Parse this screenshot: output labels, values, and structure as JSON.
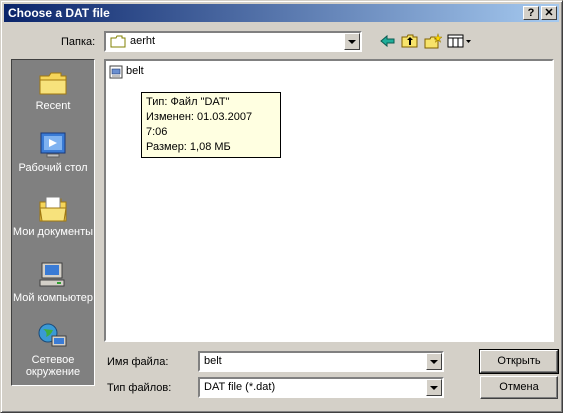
{
  "window": {
    "title": "Choose a DAT file",
    "help_label": "?",
    "close_label": "✕"
  },
  "lookin": {
    "label": "Папка:",
    "value": "aerht"
  },
  "toolbar": {
    "icons": [
      "back-icon",
      "up-folder-icon",
      "new-folder-icon",
      "view-menu-icon"
    ]
  },
  "places": [
    {
      "label": "Recent",
      "icon": "recent-icon"
    },
    {
      "label": "Рабочий стол",
      "icon": "desktop-icon"
    },
    {
      "label": "Мои документы",
      "icon": "my-documents-icon"
    },
    {
      "label": "Мой компьютер",
      "icon": "my-computer-icon"
    },
    {
      "label": "Сетевое окружение",
      "icon": "network-icon"
    }
  ],
  "files": [
    {
      "name": "belt",
      "icon": "dat-file-icon"
    }
  ],
  "tooltip": {
    "type": "Тип: Файл \"DAT\"",
    "modified": "Изменен: 01.03.2007 7:06",
    "size": "Размер: 1,08 МБ"
  },
  "filename": {
    "label": "Имя файла:",
    "value": "belt"
  },
  "filetype": {
    "label": "Тип файлов:",
    "value": "DAT file (*.dat)"
  },
  "buttons": {
    "open": "Открыть",
    "cancel": "Отмена"
  },
  "colors": {
    "title_start": "#0a246a",
    "title_end": "#a6caf0",
    "face": "#d4d0c8",
    "places_bg": "#808080",
    "tooltip_bg": "#ffffe1"
  }
}
